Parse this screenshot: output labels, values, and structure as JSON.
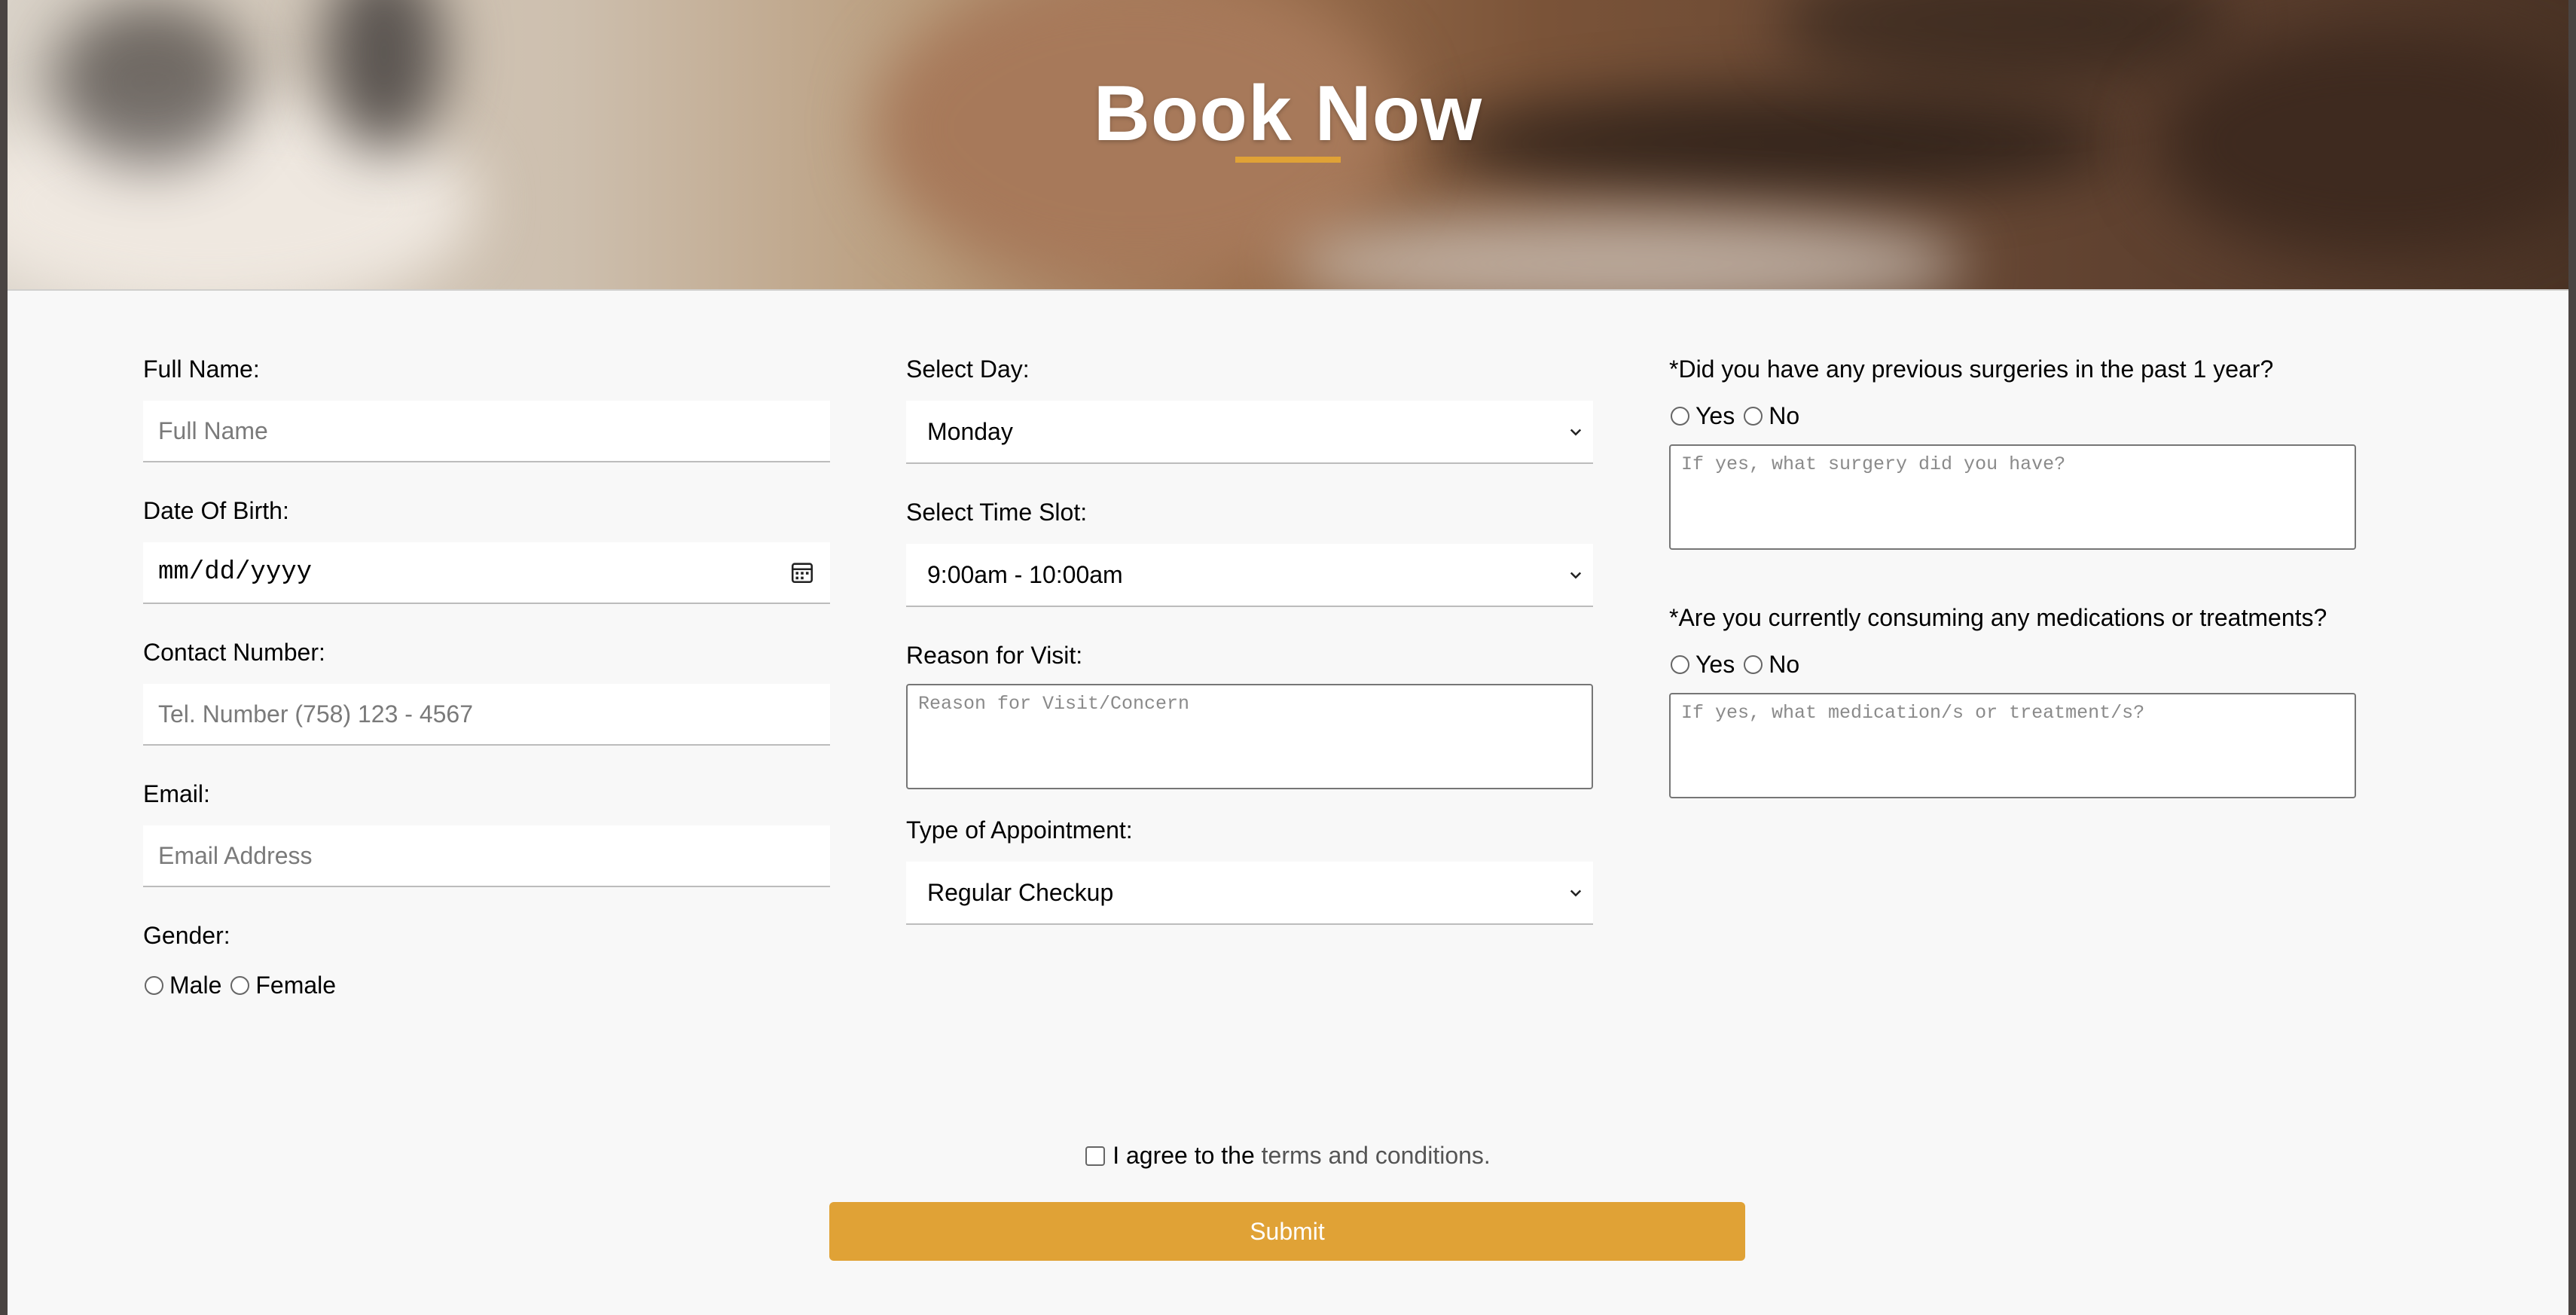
{
  "hero": {
    "title": "Book Now"
  },
  "column1": {
    "full_name": {
      "label": "Full Name:",
      "placeholder": "Full Name"
    },
    "dob": {
      "label": "Date Of Birth:",
      "value": "mm/dd/yyyy"
    },
    "contact": {
      "label": "Contact Number:",
      "placeholder": "Tel. Number (758) 123 - 4567"
    },
    "email": {
      "label": "Email:",
      "placeholder": "Email Address"
    },
    "gender": {
      "label": "Gender:",
      "options": [
        "Male",
        "Female"
      ]
    }
  },
  "column2": {
    "day": {
      "label": "Select Day:",
      "value": "Monday"
    },
    "time": {
      "label": "Select Time Slot:",
      "value": "9:00am - 10:00am"
    },
    "reason": {
      "label": "Reason for Visit:",
      "placeholder": "Reason for Visit/Concern"
    },
    "type": {
      "label": "Type of Appointment:",
      "value": "Regular Checkup"
    }
  },
  "column3": {
    "surgery": {
      "label": "*Did you have any previous surgeries in the past 1 year?",
      "options": [
        "Yes",
        "No"
      ],
      "placeholder": "If yes, what surgery did you have?"
    },
    "medication": {
      "label": "*Are you currently consuming any medications or treatments?",
      "options": [
        "Yes",
        "No"
      ],
      "placeholder": "If yes, what medication/s or treatment/s?"
    }
  },
  "agreement": {
    "prefix": "I agree to the ",
    "link": "terms and conditions."
  },
  "submit": {
    "label": "Submit"
  },
  "colors": {
    "accent": "#e0a236",
    "background": "#f8f8f8"
  },
  "icons": [
    "calendar-icon",
    "chevron-down-icon"
  ]
}
